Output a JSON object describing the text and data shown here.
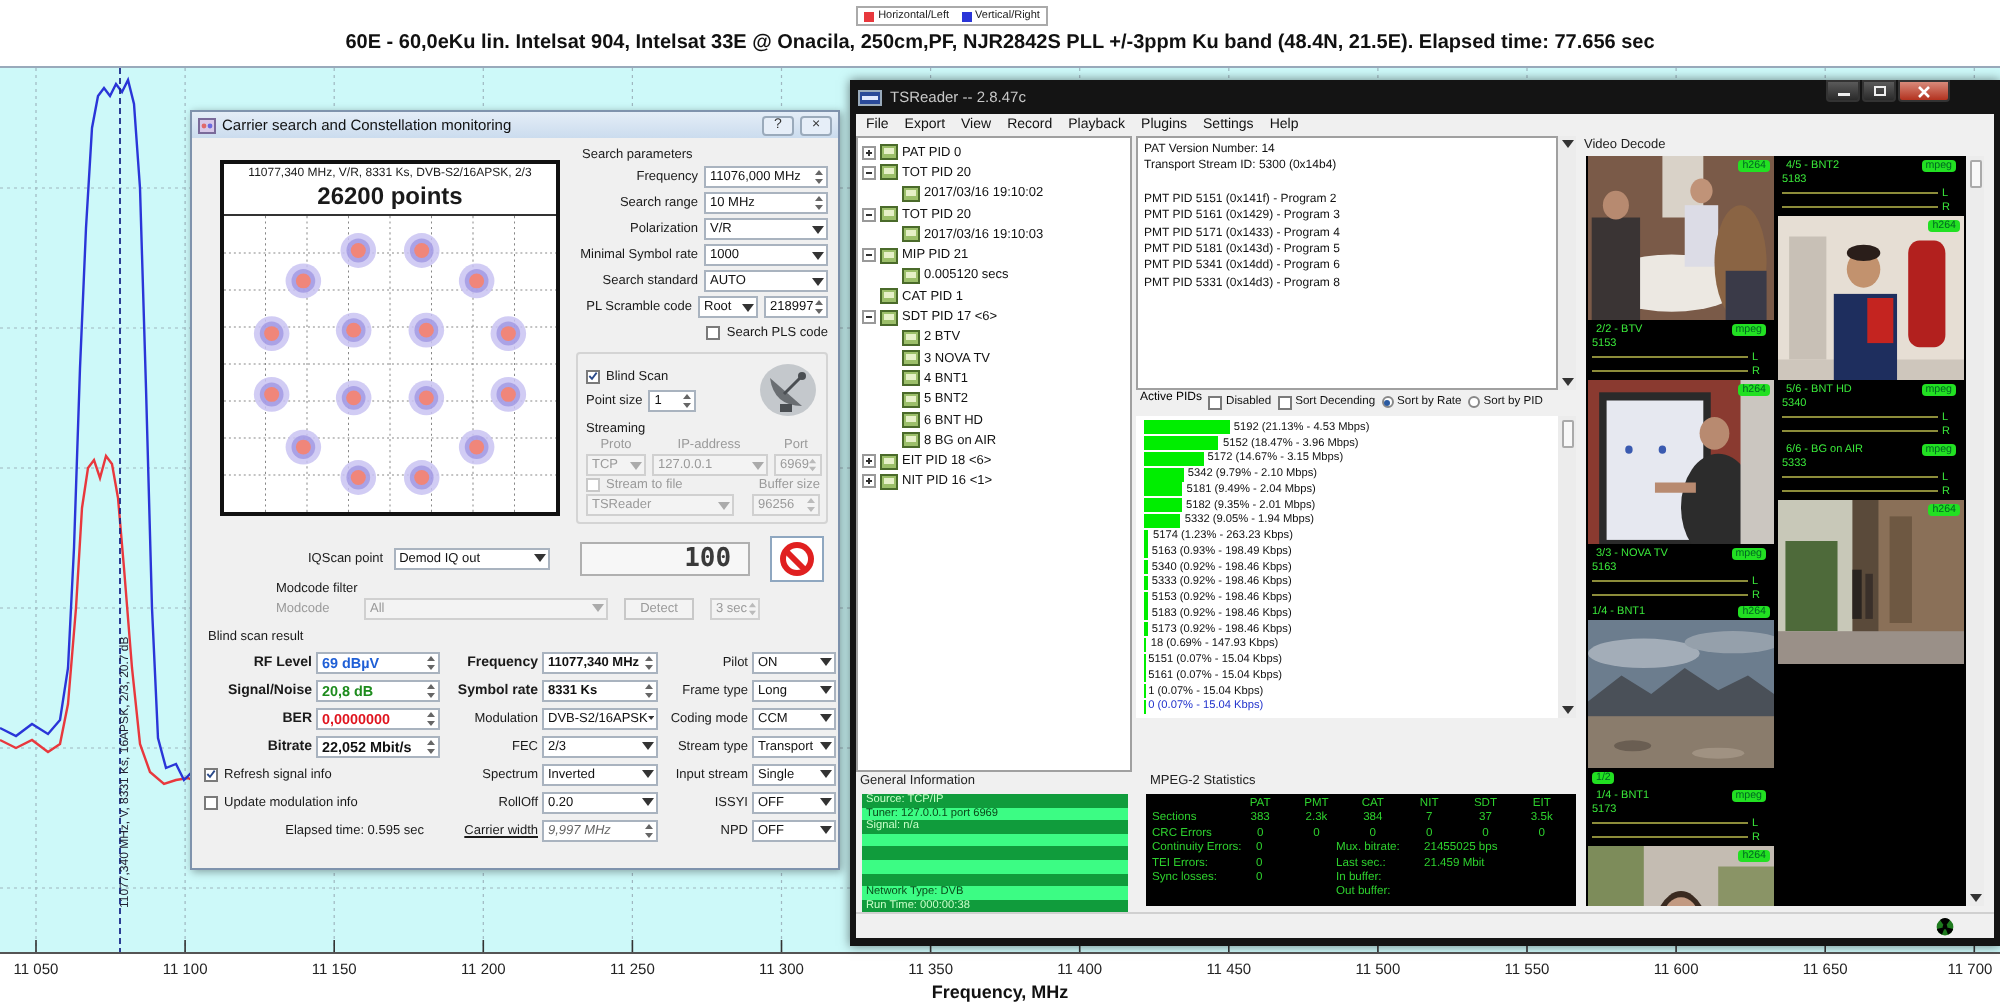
{
  "chart": {
    "legend": [
      {
        "label": "Horizontal/Left",
        "color": "#e8383d"
      },
      {
        "label": "Vertical/Right",
        "color": "#2a35d8"
      }
    ],
    "title": "60E - 60,0eKu lin. Intelsat 904, Intelsat 33E @ Onacila, 250cm,PF, NJR2842S PLL +/-3ppm Ku band (48.4N, 21.5E). Elapsed time: 77.656 sec",
    "marker_label": "11077,340 MHz, V, 8331 Ks, 16APSK, 2/3, 20.7 dB",
    "x_ticks": [
      "11 050",
      "11 100",
      "11 150",
      "11 200",
      "11 250",
      "11 300",
      "11 350",
      "11 400",
      "11 450",
      "11 500",
      "11 550",
      "11 600",
      "11 650",
      "11 700"
    ],
    "x_label": "Frequency, MHz"
  },
  "carrier_window": {
    "title": "Carrier search and Constellation monitoring",
    "title_buttons": [
      "?",
      "×"
    ],
    "constellation": {
      "caption": "11077,340 MHz, V/R, 8331 Ks, DVB-S2/16APSK, 2/3",
      "points": "26200 points"
    },
    "search": {
      "title": "Search parameters",
      "fields": [
        {
          "label": "Frequency",
          "value": "11076,000 MHz",
          "kind": "spin"
        },
        {
          "label": "Search range",
          "value": "10 MHz",
          "kind": "spin"
        },
        {
          "label": "Polarization",
          "value": "V/R",
          "kind": "dropdown"
        },
        {
          "label": "Minimal Symbol rate",
          "value": "1000",
          "kind": "dropdown"
        },
        {
          "label": "Search standard",
          "value": "AUTO",
          "kind": "dropdown"
        },
        {
          "label": "PL Scramble code",
          "value": "Root",
          "code": "218997",
          "kind": "scramble"
        }
      ],
      "pls": {
        "label": "Search PLS code",
        "checked": false
      }
    },
    "blind_scan": {
      "label": "Blind Scan",
      "checked": true
    },
    "point_size": {
      "label": "Point size",
      "value": "1"
    },
    "streaming": {
      "title": "Streaming",
      "disabled": true,
      "headers": [
        "Proto",
        "IP-address",
        "Port"
      ],
      "proto": "TCP",
      "ip": "127.0.0.1",
      "port": "6969",
      "to_file": {
        "label": "Stream to file",
        "checked": false
      },
      "buffer_label": "Buffer size",
      "target": "TSReader",
      "buffer": "96256"
    },
    "iq_scan": {
      "label": "IQScan point",
      "value": "Demod IQ out"
    },
    "counter": "100",
    "modcode": {
      "title": "Modcode filter",
      "label": "Modcode",
      "value": "All",
      "detect": "Detect",
      "interval": "3 sec",
      "disabled": true
    },
    "result": {
      "title": "Blind scan result",
      "metrics": [
        {
          "label": "RF Level",
          "value": "69 dBµV",
          "color": "#1f5fd6"
        },
        {
          "label": "Signal/Noise",
          "value": "20,8 dB",
          "color": "#1e8c1e"
        },
        {
          "label": "BER",
          "value": "0,0000000",
          "color": "#e0141e"
        },
        {
          "label": "Bitrate",
          "value": "22,052 Mbit/s",
          "color": "#111111"
        }
      ],
      "options": [
        {
          "label": "Refresh signal info",
          "checked": true
        },
        {
          "label": "Update modulation info",
          "checked": false
        }
      ],
      "elapsed": "Elapsed time: 0.595 sec",
      "params": [
        {
          "label": "Frequency",
          "value": "11077,340 MHz",
          "kind": "key"
        },
        {
          "label": "Symbol rate",
          "value": "8331 Ks",
          "kind": "key"
        },
        {
          "label": "Modulation",
          "value": "DVB-S2/16APSK",
          "kind": "dropdown"
        },
        {
          "label": "FEC",
          "value": "2/3",
          "kind": "dropdown"
        },
        {
          "label": "Spectrum",
          "value": "Inverted",
          "kind": "dropdown"
        },
        {
          "label": "RollOff",
          "value": "0.20",
          "kind": "dropdown"
        },
        {
          "label": "Carrier width",
          "value": "9,997 MHz",
          "kind": "link"
        }
      ],
      "modes": [
        {
          "label": "Pilot",
          "value": "ON"
        },
        {
          "label": "Frame type",
          "value": "Long"
        },
        {
          "label": "Coding mode",
          "value": "CCM"
        },
        {
          "label": "Stream type",
          "value": "Transport"
        },
        {
          "label": "Input stream",
          "value": "Single"
        },
        {
          "label": "ISSYI",
          "value": "OFF"
        },
        {
          "label": "NPD",
          "value": "OFF"
        }
      ]
    }
  },
  "tsreader": {
    "title": "TSReader -- 2.8.47c",
    "menu": [
      "File",
      "Export",
      "View",
      "Record",
      "Playback",
      "Plugins",
      "Settings",
      "Help"
    ],
    "tree": [
      {
        "label": "PAT PID 0",
        "expanded": false
      },
      {
        "label": "TOT PID 20",
        "expanded": true,
        "children": [
          {
            "label": "2017/03/16 19:10:02"
          }
        ]
      },
      {
        "label": "TOT PID 20",
        "expanded": true,
        "children": [
          {
            "label": "2017/03/16 19:10:03"
          }
        ]
      },
      {
        "label": "MIP PID 21",
        "expanded": true,
        "children": [
          {
            "label": "0.005120 secs"
          }
        ]
      },
      {
        "label": "CAT PID 1"
      },
      {
        "label": "SDT PID 17 <6>",
        "expanded": true,
        "children": [
          {
            "label": "2 BTV"
          },
          {
            "label": "3 NOVA TV"
          },
          {
            "label": "4 BNT1"
          },
          {
            "label": "5 BNT2"
          },
          {
            "label": "6 BNT HD"
          },
          {
            "label": "8 BG on AIR"
          }
        ]
      },
      {
        "label": "EIT PID 18 <6>",
        "expanded": false
      },
      {
        "label": "NIT PID 16 <1>",
        "expanded": false
      }
    ],
    "pat_info": {
      "header": [
        "PAT Version Number: 14",
        "Transport Stream ID: 5300 (0x14b4)"
      ],
      "programs": [
        "PMT PID 5151 (0x141f) - Program 2",
        "PMT PID 5161 (0x1429) - Program 3",
        "PMT PID 5171 (0x1433) - Program 4",
        "PMT PID 5181 (0x143d) - Program 5",
        "PMT PID 5341 (0x14dd) - Program 6",
        "PMT PID 5331 (0x14d3) - Program 8"
      ]
    },
    "active_pids": {
      "title": "Active PIDs",
      "filters": [
        {
          "label": "Disabled",
          "kind": "checkbox",
          "checked": false
        },
        {
          "label": "Sort Decending",
          "kind": "checkbox",
          "checked": false
        },
        {
          "label": "Sort by Rate",
          "kind": "radio",
          "selected": true
        },
        {
          "label": "Sort by PID",
          "kind": "radio",
          "selected": false
        }
      ],
      "pids": [
        {
          "text": "5192 (21.13% - 4.53 Mbps)",
          "level": 0.2113,
          "selected": false
        },
        {
          "text": "5152 (18.47% - 3.96 Mbps)",
          "level": 0.1847,
          "selected": false
        },
        {
          "text": "5172 (14.67% - 3.15 Mbps)",
          "level": 0.1467,
          "selected": false
        },
        {
          "text": "5342 (9.79% - 2.10 Mbps)",
          "level": 0.0979,
          "selected": false
        },
        {
          "text": "5181 (9.49% - 2.04 Mbps)",
          "level": 0.0949,
          "selected": false
        },
        {
          "text": "5182 (9.35% - 2.01 Mbps)",
          "level": 0.0935,
          "selected": false
        },
        {
          "text": "5332 (9.05% - 1.94 Mbps)",
          "level": 0.0905,
          "selected": false
        },
        {
          "text": "5174 (1.23% - 263.23 Kbps)",
          "level": 0.0123,
          "selected": false
        },
        {
          "text": "5163 (0.93% - 198.49 Kbps)",
          "level": 0.0093,
          "selected": false
        },
        {
          "text": "5340 (0.92% - 198.46 Kbps)",
          "level": 0.0092,
          "selected": false
        },
        {
          "text": "5333 (0.92% - 198.46 Kbps)",
          "level": 0.0092,
          "selected": false
        },
        {
          "text": "5153 (0.92% - 198.46 Kbps)",
          "level": 0.0092,
          "selected": false
        },
        {
          "text": "5183 (0.92% - 198.46 Kbps)",
          "level": 0.0092,
          "selected": false
        },
        {
          "text": "5173 (0.92% - 198.46 Kbps)",
          "level": 0.0092,
          "selected": false
        },
        {
          "text": "18 (0.69% - 147.93 Kbps)",
          "level": 0.0069,
          "selected": false
        },
        {
          "text": "5151 (0.07% - 15.04 Kbps)",
          "level": 0.0007,
          "selected": false
        },
        {
          "text": "5161 (0.07% - 15.04 Kbps)",
          "level": 0.0007,
          "selected": false
        },
        {
          "text": "1 (0.07% - 15.04 Kbps)",
          "level": 0.0007,
          "selected": false
        },
        {
          "text": "0 (0.07% - 15.04 Kbps)",
          "level": 0.0007,
          "selected": true
        }
      ]
    },
    "general_info": {
      "title": "General Information",
      "rows": [
        "Source: TCP/IP",
        "Tuner: 127.0.0.1 port 6969",
        "Signal: n/a",
        "Network Type: DVB",
        "Run Time: 000:00:38"
      ]
    },
    "mpeg2": {
      "title": "MPEG-2 Statistics",
      "columns": [
        "PAT",
        "PMT",
        "CAT",
        "NIT",
        "SDT",
        "EIT"
      ],
      "rows": [
        {
          "label": "Sections",
          "values": [
            "383",
            "2.3k",
            "384",
            "7",
            "37",
            "3.5k"
          ]
        },
        {
          "label": "CRC Errors",
          "values": [
            "0",
            "0",
            "0",
            "0",
            "0",
            "0"
          ]
        }
      ],
      "counters": [
        {
          "label": "Continuity Errors:",
          "value": "0"
        },
        {
          "label": "TEI Errors:",
          "value": "0"
        },
        {
          "label": "Sync losses:",
          "value": "0"
        }
      ],
      "buffer": [
        {
          "label": "Mux. bitrate:",
          "value": "21455025 bps"
        },
        {
          "label": "Last sec.:",
          "value": "21.459 Mbit"
        },
        {
          "label": "In buffer:"
        },
        {
          "label": "Out buffer:"
        }
      ]
    },
    "video_decode": {
      "title": "Video Decode",
      "columns": [
        [
          {
            "kind": "video",
            "codec": "h264"
          },
          {
            "kind": "audio",
            "name": "2/2 - BTV",
            "codec": "mpeg",
            "pid": "5153",
            "channels": [
              "L",
              "R"
            ]
          },
          {
            "kind": "video",
            "codec": "h264"
          },
          {
            "kind": "audio",
            "name": "3/3 - NOVA TV",
            "codec": "mpeg",
            "pid": "5163",
            "channels": [
              "L",
              "R"
            ]
          },
          {
            "kind": "video",
            "codec": "h264",
            "caption": "1/4 - BNT1"
          },
          {
            "kind": "tag",
            "text": "1/2"
          },
          {
            "kind": "audio",
            "name": "1/4 - BNT1",
            "codec": "mpeg",
            "pid": "5173",
            "channels": [
              "L",
              "R"
            ]
          },
          {
            "kind": "video",
            "codec": "h264"
          }
        ],
        [
          {
            "kind": "audio",
            "name": "4/5 - BNT2",
            "codec": "mpeg",
            "pid": "5183",
            "channels": [
              "L",
              "R"
            ]
          },
          {
            "kind": "video",
            "codec": "h264"
          },
          {
            "kind": "audio",
            "name": "5/6 - BNT HD",
            "codec": "mpeg",
            "pid": "5340",
            "channels": [
              "L",
              "R"
            ]
          },
          {
            "kind": "audio",
            "name": "6/6 - BG on AIR",
            "codec": "mpeg",
            "pid": "5333",
            "channels": [
              "L",
              "R"
            ]
          },
          {
            "kind": "video",
            "codec": "h264"
          }
        ]
      ]
    }
  }
}
